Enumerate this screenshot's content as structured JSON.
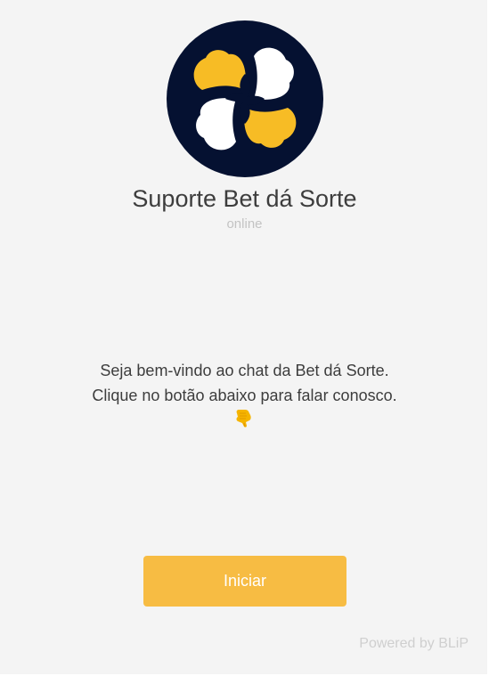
{
  "bot": {
    "name": "Suporte Bet dá Sorte",
    "status": "online",
    "avatar_icon": "four-leaf-clover-logo-icon",
    "avatar_colors": {
      "background": "#051131",
      "yellow": "#f7bc25",
      "white": "#ffffff"
    }
  },
  "welcome": {
    "line1": "Seja bem-vindo ao chat da Bet dá Sorte.",
    "line2": "Clique no botão abaixo para falar conosco.",
    "emoji_icon": "pointing-down-hand-icon"
  },
  "start_button": {
    "label": "Iniciar",
    "color": "#f7bc43"
  },
  "footer": {
    "powered_by": "Powered by BLiP"
  }
}
